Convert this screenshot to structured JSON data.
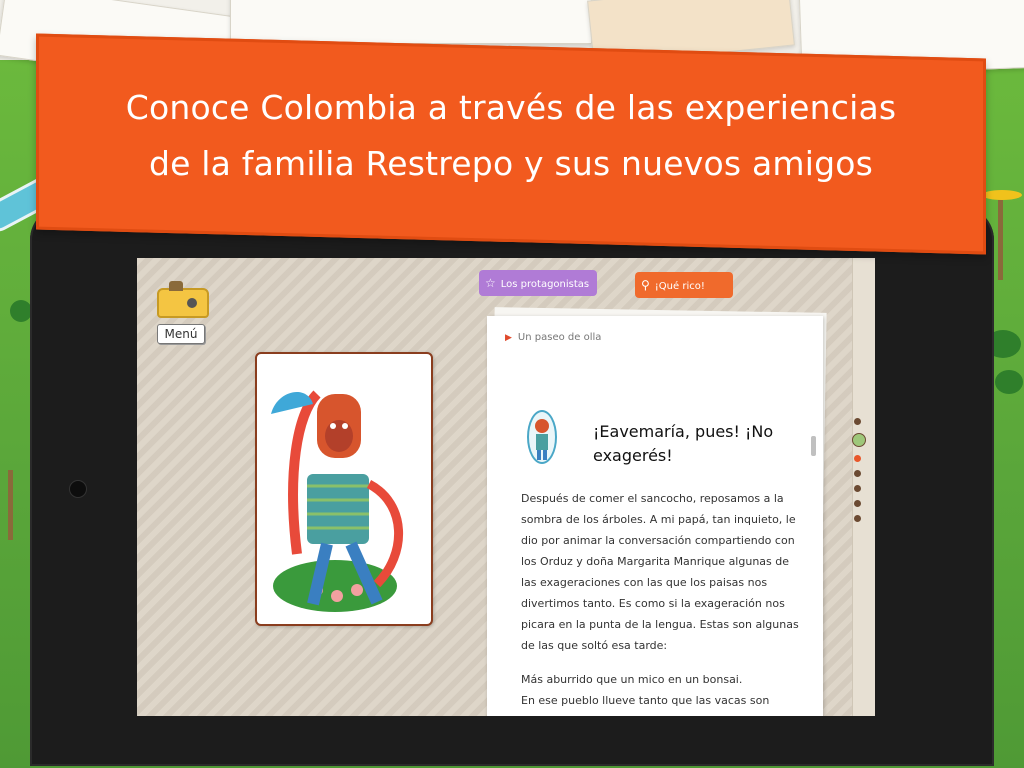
{
  "banner": {
    "line1": "Conoce Colombia a través de las experiencias",
    "line2": "de la familia Restrepo y sus nuevos amigos"
  },
  "app": {
    "menu_label": "Menú",
    "tabs": [
      {
        "label": "Los protagonistas",
        "icon": "star-icon",
        "color": "#b07bd6"
      },
      {
        "label": "¡Qué rico!",
        "icon": "fork-spoon-icon",
        "color": "#f06a2c"
      }
    ],
    "breadcrumb": "Un paseo de olla",
    "headline": "¡Eavemaría, pues! ¡No exagerés!",
    "paragraphs": [
      "Después de comer el sancocho, reposamos a la sombra de los árboles. A mi papá, tan inquieto, le dio por animar la conversación compartiendo con los Orduz y doña Margarita Manrique algunas de las exageraciones con las que los paisas nos divertimos tanto. Es como si la exageración nos picara en la punta de la lengua. Estas son algunas de las que soltó esa tarde:",
      "Más aburrido que un mico en un bonsai.",
      "En ese pueblo llueve tanto que las vacas son"
    ]
  },
  "colors": {
    "banner": "#f25a1e",
    "accent_red": "#e04a2c",
    "dot_brown": "#6b4a32"
  }
}
